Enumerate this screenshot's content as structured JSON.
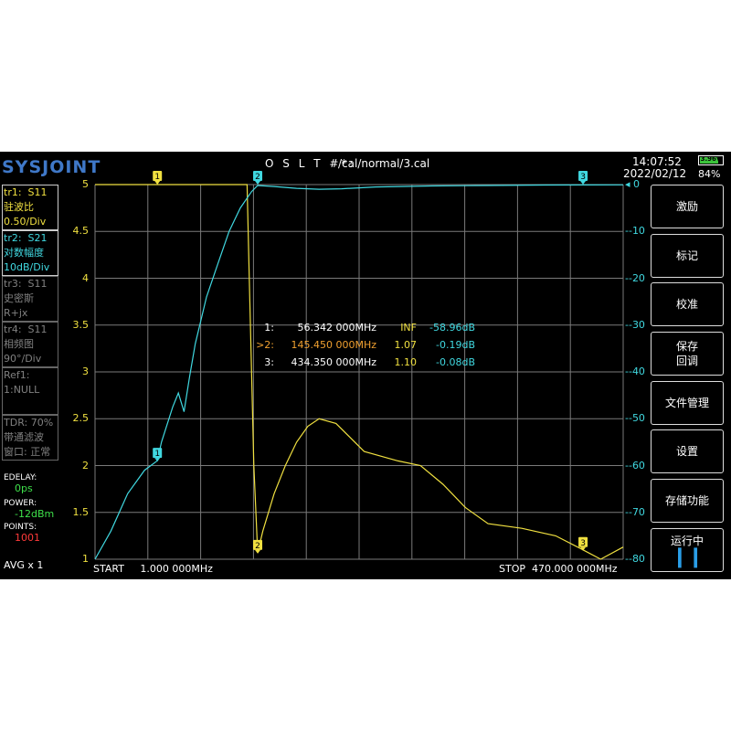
{
  "header": {
    "logo": "SYSJOINT",
    "cal_title": "O S L T #*:",
    "cal_path": "/cal/normal/3.cal",
    "time": "14:07:52",
    "date": "2022/02/12",
    "battery_voltage": "3.96V",
    "battery_percent": "84%",
    "battery_level": 0.84
  },
  "traces": [
    {
      "id": "tr1:",
      "param": "S11",
      "format": "驻波比",
      "scale": "0.50/Div",
      "color": "#f0e040"
    },
    {
      "id": "tr2:",
      "param": "S21",
      "format": "对数幅度",
      "scale": "10dB/Div",
      "color": "#40d8e0"
    },
    {
      "id": "tr3:",
      "param": "S11",
      "format": "史密斯",
      "scale": "R+jx"
    },
    {
      "id": "tr4:",
      "param": "S11",
      "format": "相频图",
      "scale": "90°/Div"
    }
  ],
  "ref": {
    "label": "Ref1:",
    "value": "1:NULL"
  },
  "tdr": {
    "label": "TDR: 70%",
    "filter": "带通滤波",
    "window": "窗口: 正常"
  },
  "settings": {
    "edelay_label": "EDELAY:",
    "edelay_value": "0ps",
    "power_label": "POWER:",
    "power_value": "-12dBm",
    "points_label": "POINTS:",
    "points_value": "1001",
    "avg": "AVG x 1"
  },
  "softkeys": [
    {
      "label": "激励"
    },
    {
      "label": "标记"
    },
    {
      "label": "校准"
    },
    {
      "label": "保存\n回调"
    },
    {
      "label": "文件管理"
    },
    {
      "label": "设置"
    },
    {
      "label": "存储功能"
    },
    {
      "label": "运行中",
      "icon": "pause-icon"
    }
  ],
  "markers": {
    "table": [
      {
        "id": "1:",
        "freq": "56.342 000MHz",
        "swr": "INF",
        "s21": "-58.96dB",
        "active": false
      },
      {
        "id": ">2:",
        "freq": "145.450 000MHz",
        "swr": "1.07",
        "s21": "-0.19dB",
        "active": true
      },
      {
        "id": "3:",
        "freq": "434.350 000MHz",
        "swr": "1.10",
        "s21": "-0.08dB",
        "active": false
      }
    ],
    "flags": [
      "1",
      "2",
      "3"
    ]
  },
  "axes": {
    "left_ticks": [
      "5",
      "4.5",
      "4",
      "3.5",
      "3",
      "2.5",
      "2",
      "1.5",
      "1"
    ],
    "right_ticks": [
      "0",
      "-10",
      "-20",
      "-30",
      "-40",
      "-50",
      "-60",
      "-70",
      "-80"
    ],
    "start_label": "START",
    "start_value": "1.000 000MHz",
    "stop_label": "STOP",
    "stop_value": "470.000 000MHz"
  },
  "chart_data": {
    "type": "line",
    "x_unit": "MHz",
    "xlim": [
      1,
      470
    ],
    "left_ylim": [
      1,
      5
    ],
    "right_ylim": [
      -80,
      0
    ],
    "grid": true,
    "series": [
      {
        "name": "tr1: S11",
        "axis": "left",
        "color": "#f0e040",
        "x": [
          1,
          120,
          136,
          138,
          140,
          142,
          145.45,
          150,
          160,
          170,
          180,
          190,
          200,
          215,
          240,
          270,
          290,
          310,
          330,
          350,
          380,
          410,
          434.35,
          450,
          470
        ],
        "y": [
          5.0,
          5.0,
          5.0,
          4.0,
          3.0,
          2.0,
          1.07,
          1.3,
          1.7,
          2.0,
          2.25,
          2.42,
          2.5,
          2.45,
          2.15,
          2.05,
          2.0,
          1.8,
          1.55,
          1.38,
          1.33,
          1.25,
          1.1,
          1.0,
          1.13
        ]
      },
      {
        "name": "tr2: S21",
        "axis": "right",
        "color": "#40d8e0",
        "x": [
          1,
          15,
          30,
          45,
          56.342,
          60,
          70,
          75,
          80,
          85,
          90,
          100,
          110,
          120,
          130,
          140,
          145.45,
          160,
          180,
          200,
          220,
          250,
          300,
          350,
          400,
          434.35,
          470
        ],
        "y": [
          -80,
          -74,
          -66,
          -61,
          -58.96,
          -55,
          -47.5,
          -44.5,
          -48.5,
          -41,
          -34,
          -24,
          -17,
          -10,
          -5,
          -1.5,
          -0.19,
          -0.4,
          -0.8,
          -1.0,
          -0.9,
          -0.5,
          -0.3,
          -0.2,
          -0.1,
          -0.08,
          -0.05
        ]
      }
    ],
    "markers": [
      {
        "label": "1",
        "x": 56.342,
        "series": "tr2: S21"
      },
      {
        "label": "2",
        "x": 145.45,
        "series": "both"
      },
      {
        "label": "3",
        "x": 434.35,
        "series": "both"
      }
    ]
  }
}
